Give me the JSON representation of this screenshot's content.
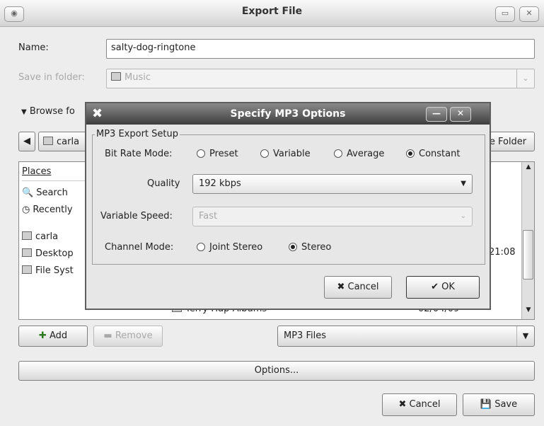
{
  "window": {
    "title": "Export File"
  },
  "form": {
    "name_label": "Name:",
    "name_value": "salty-dog-ringtone",
    "save_in_label": "Save in folder:",
    "save_in_value": "Music",
    "browse_label": "Browse fo",
    "path_button": "carla",
    "create_folder_button": "e Folder"
  },
  "places": {
    "header": "Places",
    "items": [
      "Search",
      "Recently",
      "carla",
      "Desktop",
      "File Syst"
    ]
  },
  "files": {
    "visible_row_name": "Terry-Hap-Albums",
    "visible_row_date": "02/04/09",
    "partial_time": "21:08"
  },
  "bottom": {
    "add_button": "Add",
    "remove_button": "Remove",
    "filter_value": "MP3 Files",
    "options_button": "Options...",
    "cancel_button": "Cancel",
    "save_button": "Save"
  },
  "dialog": {
    "title": "Specify MP3 Options",
    "frame_label": "MP3 Export Setup",
    "bit_rate_label": "Bit Rate Mode:",
    "bit_rate_options": [
      "Preset",
      "Variable",
      "Average",
      "Constant"
    ],
    "bit_rate_selected": "Constant",
    "quality_label": "Quality",
    "quality_value": "192 kbps",
    "variable_speed_label": "Variable Speed:",
    "variable_speed_value": "Fast",
    "channel_mode_label": "Channel Mode:",
    "channel_options": [
      "Joint Stereo",
      "Stereo"
    ],
    "channel_selected": "Stereo",
    "cancel_button": "Cancel",
    "ok_button": "OK"
  }
}
